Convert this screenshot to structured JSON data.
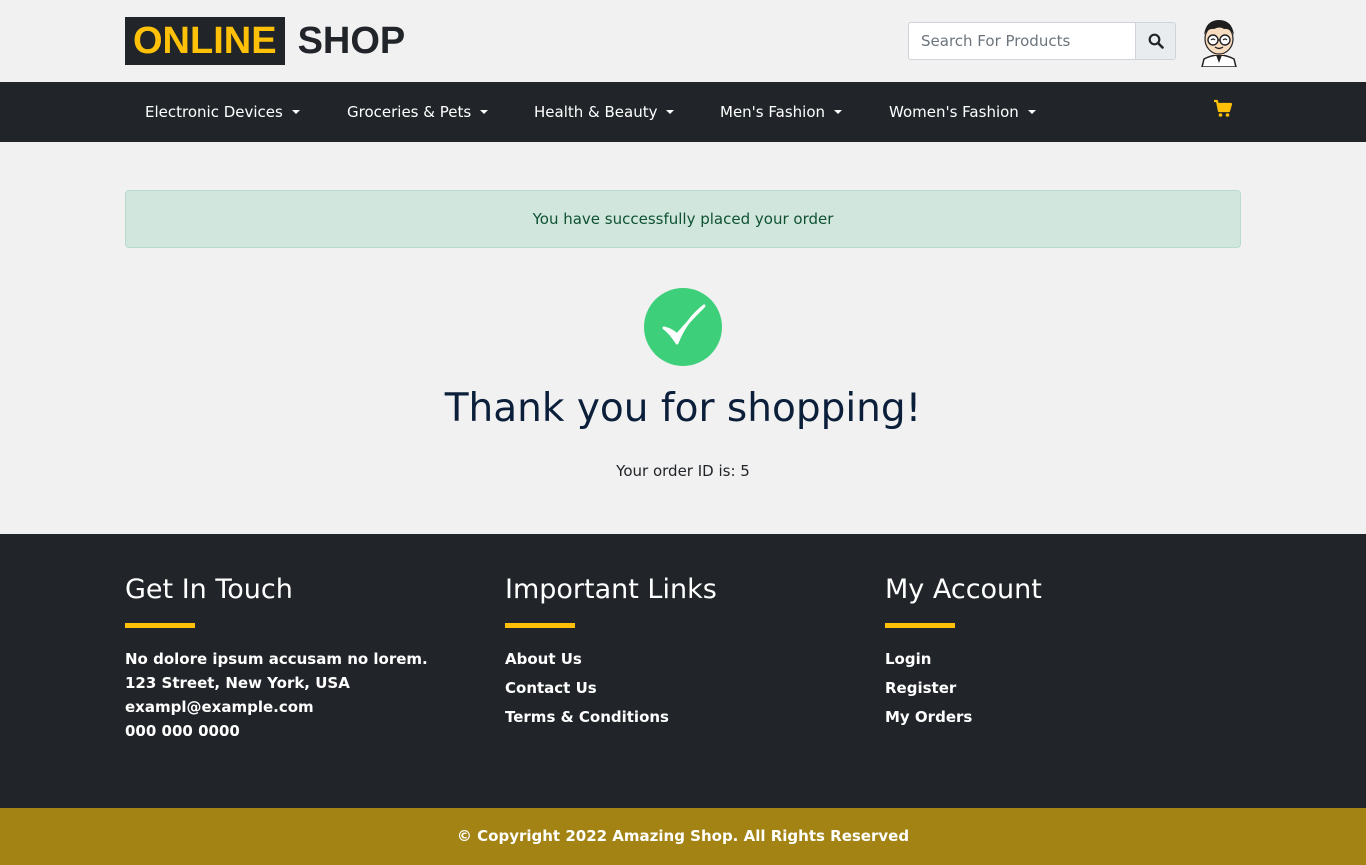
{
  "brand": {
    "logo_highlight": "ONLINE",
    "logo_rest": "SHOP"
  },
  "search": {
    "placeholder": "Search For Products",
    "button_icon": "search-icon"
  },
  "header": {
    "avatar_icon": "user-avatar-icon"
  },
  "nav": {
    "items": [
      {
        "label": "Electronic Devices"
      },
      {
        "label": "Groceries & Pets"
      },
      {
        "label": "Health & Beauty"
      },
      {
        "label": "Men's Fashion"
      },
      {
        "label": "Women's Fashion"
      }
    ],
    "cart_icon": "shopping-cart-icon"
  },
  "alert": {
    "message": "You have successfully placed your order"
  },
  "confirmation": {
    "icon": "check-circle-icon",
    "title": "Thank you for shopping!",
    "order_id_text": "Your order ID is: 5"
  },
  "footer": {
    "contact": {
      "heading": "Get In Touch",
      "lines": [
        "No dolore ipsum accusam no lorem.",
        "123 Street, New York, USA",
        "exampl@example.com",
        "000 000 0000"
      ]
    },
    "links": {
      "heading": "Important Links",
      "items": [
        "About Us",
        "Contact Us",
        "Terms & Conditions"
      ]
    },
    "account": {
      "heading": "My Account",
      "items": [
        "Login",
        "Register",
        "My Orders"
      ]
    },
    "copyright": "© Copyright 2022 Amazing Shop. All Rights Reserved"
  },
  "colors": {
    "accent": "#ffc107",
    "dark": "#212529",
    "success": "#3ecf7a",
    "alert_bg": "#d1e7dd",
    "copyright_bg": "#a28313"
  }
}
